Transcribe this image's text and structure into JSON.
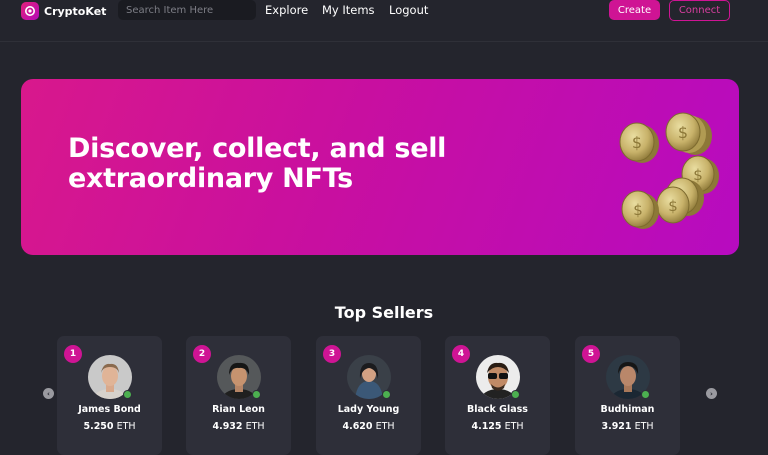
{
  "nav": {
    "brand": "CryptoKet",
    "search_placeholder": "Search Item Here",
    "links": [
      "Explore",
      "My Items",
      "Logout"
    ],
    "create_label": "Create",
    "connect_label": "Connect"
  },
  "hero": {
    "title_line1": "Discover, collect, and sell",
    "title_line2": "extraordinary NFTs"
  },
  "top_sellers": {
    "title": "Top Sellers",
    "sellers": [
      {
        "rank": "1",
        "name": "James Bond",
        "amount": "5.250",
        "currency": "ETH"
      },
      {
        "rank": "2",
        "name": "Rian Leon",
        "amount": "4.932",
        "currency": "ETH"
      },
      {
        "rank": "3",
        "name": "Lady Young",
        "amount": "4.620",
        "currency": "ETH"
      },
      {
        "rank": "4",
        "name": "Black Glass",
        "amount": "4.125",
        "currency": "ETH"
      },
      {
        "rank": "5",
        "name": "Budhiman",
        "amount": "3.921",
        "currency": "ETH"
      }
    ]
  },
  "colors": {
    "background": "#24252d",
    "accent": "#cf1494",
    "card": "#2e2f39",
    "verified": "#4caf50"
  },
  "icons": {
    "brand": "logo-icon",
    "prev": "chevron-left-icon",
    "next": "chevron-right-icon",
    "hero_art": "gold-coins-illustration"
  }
}
